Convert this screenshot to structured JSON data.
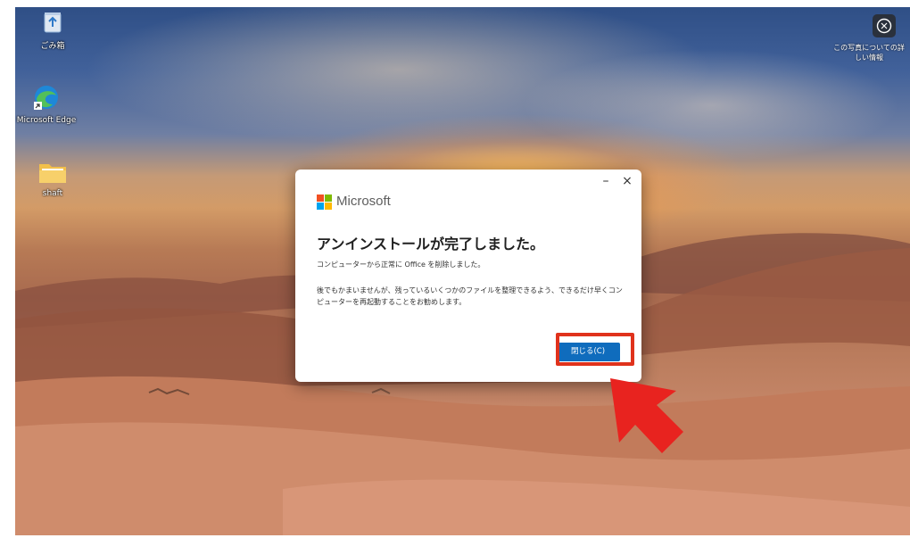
{
  "desktop": {
    "icons": [
      {
        "label": "ごみ箱",
        "icon": "recycle-bin-icon"
      },
      {
        "label": "Microsoft Edge",
        "icon": "edge-browser-icon"
      },
      {
        "label": "shaft",
        "icon": "folder-icon"
      }
    ],
    "info_widget": {
      "label": "この写真についての詳しい情報",
      "icon": "camera-info-icon"
    }
  },
  "dialog": {
    "brand": "Microsoft",
    "minimize_label": "–",
    "close_label": "×",
    "title": "アンインストールが完了しました。",
    "message": "コンピューターから正常に Office を削除しました。",
    "message2": "後でもかまいませんが、残っているいくつかのファイルを整理できるよう、できるだけ早くコンピューターを再起動することをお勧めします。",
    "button_label": "閉じる(C)",
    "accent": "#0f6cbd"
  },
  "annotation": {
    "highlight_color": "#e0321c",
    "arrow_color": "#e8231f"
  }
}
